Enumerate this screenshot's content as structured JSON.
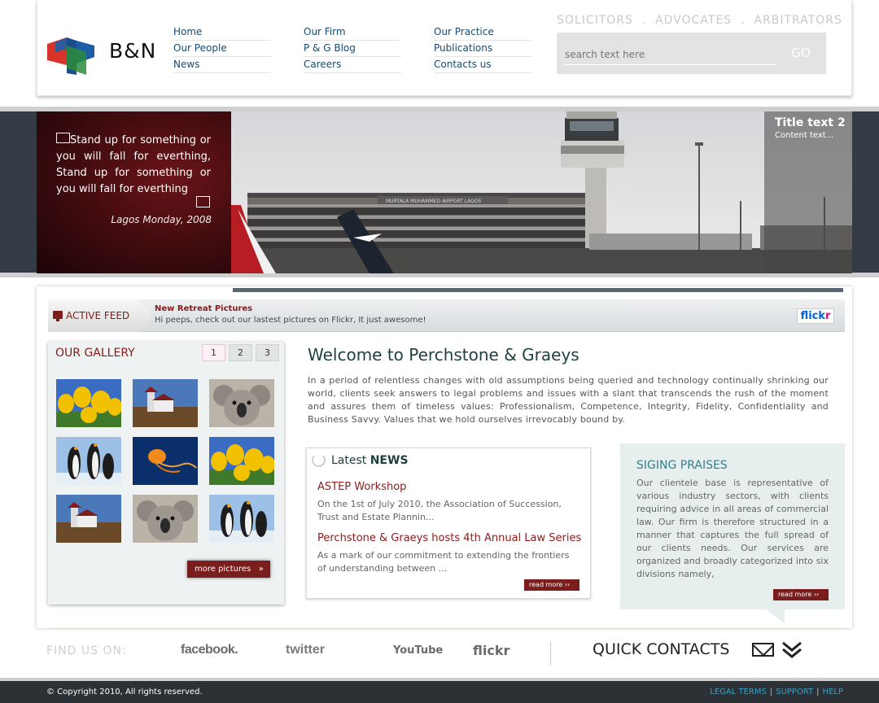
{
  "brand": {
    "logo_text": "B&N",
    "tagline": "SOLICITORS  .  ADVOCATES  .  ARBITRATORS"
  },
  "nav": {
    "col1": [
      "Home",
      "Our People",
      "News"
    ],
    "col2": [
      "Our Firm",
      "P & G Blog",
      "Careers"
    ],
    "col3": [
      "Our Practice",
      "Publications",
      "Contacts us"
    ]
  },
  "search": {
    "placeholder": "search text here",
    "go_label": "GO"
  },
  "banner": {
    "quote": "Stand up for something or you will fall for everthing, Stand up for something or you will fall for everthing",
    "date": "Lagos Monday, 2008",
    "caption_title": "Title text 2",
    "caption_text": "Content text...",
    "sign_text": "MURTALA MUHAMMED AIRPORT LAGOS"
  },
  "feed": {
    "label": "ACTIVE FEED",
    "title": "New Retreat Pictures",
    "text": "Hi peeps, check out our lastest pictures on Flickr, It just awesome!",
    "badge": "flickr"
  },
  "gallery": {
    "title": "OUR GALLERY",
    "pages": [
      "1",
      "2",
      "3"
    ],
    "more_label": "more pictures   »",
    "thumbs": [
      "tulips-photo",
      "lighthouse-photo",
      "koala-photo",
      "penguins-photo",
      "jellyfish-photo",
      "tulips-photo",
      "lighthouse-photo",
      "koala-photo",
      "penguins-photo"
    ]
  },
  "welcome": {
    "title": "Welcome to Perchstone & Graeys",
    "text": "In a period of relentless changes with old assumptions being queried and technology continually shrinking our world, clients seek answers to legal problems and issues with a slant that transcends the rush of the moment and assures them of timeless values: Professionalism, Competence, Integrity, Fidelity, Confidentiality and Business Savvy. Values that we hold ourselves irrevocably bound by."
  },
  "news": {
    "title_light": "Latest ",
    "title_bold": "NEWS",
    "items": [
      {
        "headline": "ASTEP Workshop",
        "excerpt": "On the 1st of July 2010, the Association of Succession, Trust and Estate Plannin..."
      },
      {
        "headline": "Perchstone & Graeys hosts 4th Annual Law Series",
        "excerpt": "As a mark of our commitment to extending the frontiers of understanding between ..."
      }
    ],
    "read_more": "read more ››"
  },
  "praises": {
    "title": "SIGING PRAISES",
    "text": "Our clientele base is representative of various industry sectors, with clients requiring advice in all areas of commercial law. Our firm is therefore structured in a manner that captures the full spread of our clients needs. Our services are organized and broadly categorized into six divisions namely,",
    "read_more": "read more ››"
  },
  "social": {
    "find_label": "FIND US ON:",
    "links": [
      "facebook.",
      "twitter",
      "YouTube",
      "flickr"
    ]
  },
  "quick_contacts": "QUICK CONTACTS",
  "footer": {
    "copyright": "© Copyright 2010, All rights reserved.",
    "links": [
      "LEGAL TERMS",
      "SUPPORT",
      "HELP"
    ]
  },
  "colors": {
    "accent": "#7a1d1d",
    "teal": "#3a7c8a",
    "dark": "#2c3136",
    "link": "#1a4a6e"
  }
}
